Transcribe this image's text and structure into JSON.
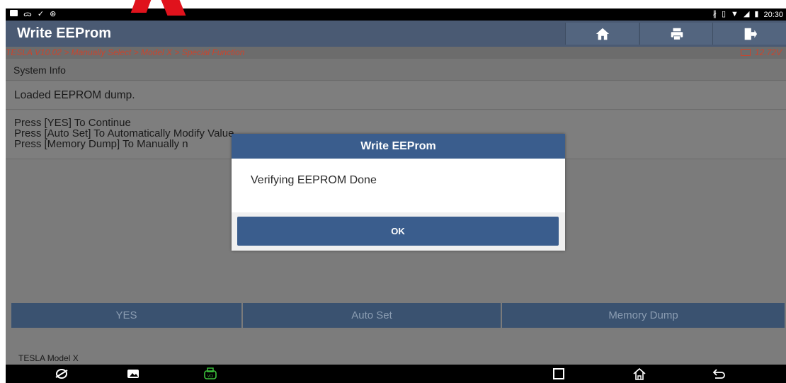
{
  "statusbar": {
    "left_icons": [
      "image-notification-icon",
      "voicemail-icon",
      "check-icon",
      "bug-icon"
    ],
    "right_icons": [
      "bluetooth-icon",
      "vibrate-icon",
      "wifi-icon",
      "signal-icon",
      "battery-icon"
    ],
    "time": "20:30"
  },
  "titlebar": {
    "title": "Write EEProm",
    "buttons": [
      "home-icon",
      "print-icon",
      "exit-icon"
    ]
  },
  "breadcrumb": {
    "path": "TESLA V10.02 > Manually Select > Model X > Special Function",
    "voltage": "12.72V"
  },
  "content": {
    "header": "System Info",
    "message1": "Loaded EEPROM dump.",
    "lines": [
      "Press [YES] To Continue",
      "Press [Auto Set] To Automatically Modify Value",
      "Press [Memory Dump] To Manually n"
    ]
  },
  "buttons": {
    "yes": "YES",
    "auto_set": "Auto Set",
    "memory_dump": "Memory Dump"
  },
  "footer": {
    "vehicle": "TESLA Model X"
  },
  "dialog": {
    "title": "Write EEProm",
    "message": "Verifying EEPROM Done",
    "ok": "OK"
  },
  "navbar": {
    "icons": [
      "browser-icon",
      "gallery-icon",
      "vci-icon",
      "recent-apps-icon",
      "home-nav-icon",
      "back-icon"
    ]
  },
  "colors": {
    "titlebar": "#4a5a73",
    "breadcrumb_text": "#c9452e",
    "button_bg": "#3a5270",
    "dialog_accent": "#3a5d8d",
    "vci_green": "#3cc43c"
  }
}
